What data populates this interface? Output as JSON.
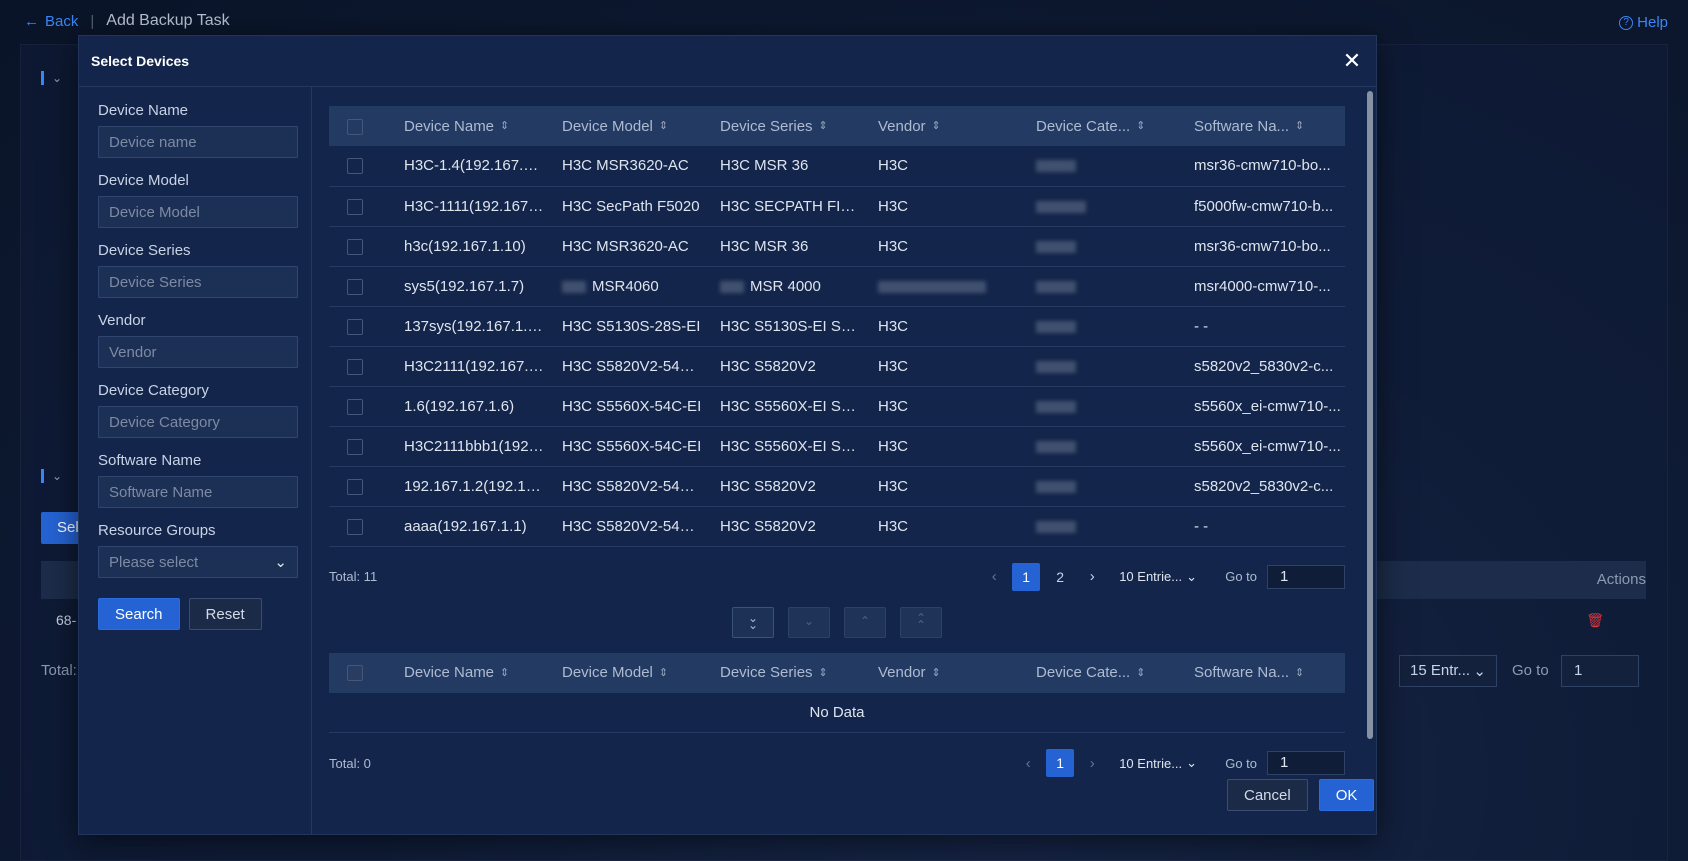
{
  "background": {
    "back_label": "Back",
    "page_title": "Add Backup Task",
    "help_label": "Help",
    "select_btn_partial": "Sel",
    "actions_header": "Actions",
    "row_id_partial": "68-",
    "total_partial": "Total:",
    "page_size": "15 Entr...",
    "goto_label": "Go to",
    "goto_value": "1"
  },
  "modal": {
    "title": "Select Devices",
    "close_glyph": "✕",
    "filters": {
      "device_name": {
        "label": "Device Name",
        "placeholder": "Device name"
      },
      "device_model": {
        "label": "Device Model",
        "placeholder": "Device Model"
      },
      "device_series": {
        "label": "Device Series",
        "placeholder": "Device Series"
      },
      "vendor": {
        "label": "Vendor",
        "placeholder": "Vendor"
      },
      "device_category": {
        "label": "Device Category",
        "placeholder": "Device Category"
      },
      "software_name": {
        "label": "Software Name",
        "placeholder": "Software Name"
      },
      "resource_groups": {
        "label": "Resource Groups",
        "placeholder": "Please select"
      },
      "search_label": "Search",
      "reset_label": "Reset"
    },
    "columns": [
      "Device Name",
      "Device Model",
      "Device Series",
      "Vendor",
      "Device Cate...",
      "Software Na..."
    ],
    "available_rows": [
      {
        "name": "H3C-1.4(192.167.1.4)",
        "model": "H3C MSR3620-AC",
        "series": "H3C MSR 36",
        "vendor": "H3C",
        "software": "msr36-cmw710-bo..."
      },
      {
        "name": "H3C-1111(192.167....",
        "model": "H3C SecPath F5020",
        "series": "H3C SECPATH FIRE...",
        "vendor": "H3C",
        "software": "f5000fw-cmw710-b..."
      },
      {
        "name": "h3c(192.167.1.10)",
        "model": "H3C MSR3620-AC",
        "series": "H3C MSR 36",
        "vendor": "H3C",
        "software": "msr36-cmw710-bo..."
      },
      {
        "name": "sys5(192.167.1.7)",
        "model": "MSR4060",
        "series": "MSR 4000",
        "vendor": "",
        "software": "msr4000-cmw710-..."
      },
      {
        "name": "137sys(192.167.1.1...",
        "model": "H3C S5130S-28S-EI",
        "series": "H3C S5130S-EI Seri...",
        "vendor": "H3C",
        "software": "- -"
      },
      {
        "name": "H3C2111(192.167.1...",
        "model": "H3C S5820V2-54Q...",
        "series": "H3C S5820V2",
        "vendor": "H3C",
        "software": "s5820v2_5830v2-c..."
      },
      {
        "name": "1.6(192.167.1.6)",
        "model": "H3C S5560X-54C-EI",
        "series": "H3C S5560X-EI Seri...",
        "vendor": "H3C",
        "software": "s5560x_ei-cmw710-..."
      },
      {
        "name": "H3C2111bbb1(192....",
        "model": "H3C S5560X-54C-EI",
        "series": "H3C S5560X-EI Seri...",
        "vendor": "H3C",
        "software": "s5560x_ei-cmw710-..."
      },
      {
        "name": "192.167.1.2(192.16...",
        "model": "H3C S5820V2-54Q...",
        "series": "H3C S5820V2",
        "vendor": "H3C",
        "software": "s5820v2_5830v2-c..."
      },
      {
        "name": "aaaa(192.167.1.1)",
        "model": "H3C S5820V2-54Q...",
        "series": "H3C S5820V2",
        "vendor": "H3C",
        "software": "- -"
      }
    ],
    "top_pager": {
      "total": "Total: 11",
      "pages": [
        "1",
        "2"
      ],
      "current": "1",
      "page_size": "10 Entrie...",
      "goto_label": "Go to",
      "goto_value": "1"
    },
    "transfer_buttons": [
      "double-chevron-down",
      "chevron-down",
      "chevron-up",
      "double-chevron-up"
    ],
    "selected_empty_text": "No Data",
    "bottom_pager": {
      "total": "Total: 0",
      "current": "1",
      "page_size": "10 Entrie...",
      "goto_label": "Go to",
      "goto_value": "1"
    },
    "cancel_label": "Cancel",
    "ok_label": "OK"
  },
  "colors": {
    "accent": "#2563d4",
    "danger": "#d9373c",
    "modal_bg": "#13254a",
    "header_row": "#233a63"
  }
}
